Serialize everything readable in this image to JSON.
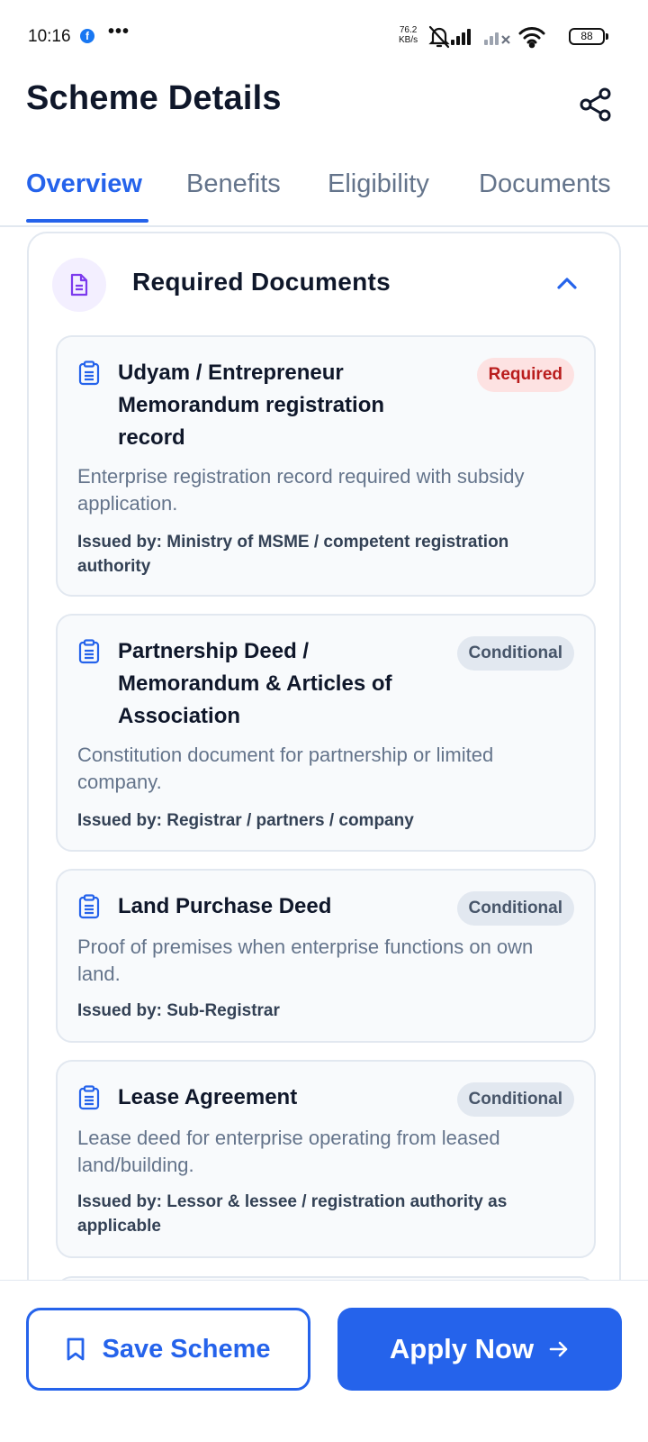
{
  "status_bar": {
    "time": "10:16",
    "fb_glyph": "f",
    "more": "•••",
    "speed_value": "76.2",
    "speed_unit": "KB/s",
    "battery": "88",
    "icons": [
      "facebook-icon",
      "mute-bell-icon",
      "signal-icon",
      "signal-no-service-icon",
      "wifi-icon",
      "battery-icon"
    ]
  },
  "header": {
    "title": "Scheme Details",
    "share_icon": "share-icon"
  },
  "tabs": [
    {
      "label": "Overview",
      "active": true
    },
    {
      "label": "Benefits",
      "active": false
    },
    {
      "label": "Eligibility",
      "active": false
    },
    {
      "label": "Documents",
      "active": false
    }
  ],
  "section": {
    "title": "Required Documents",
    "icon": "document-icon",
    "expanded": true,
    "documents": [
      {
        "title": "Udyam / Entrepreneur Memorandum registration record",
        "badge": "Required",
        "badge_type": "required",
        "description": "Enterprise registration record required with subsidy application.",
        "issued_by": "Issued by: Ministry of MSME / competent registration authority"
      },
      {
        "title": "Partnership Deed / Memorandum & Articles of Association",
        "badge": "Conditional",
        "badge_type": "conditional",
        "description": "Constitution document for partnership or limited company.",
        "issued_by": "Issued by: Registrar / partners / company"
      },
      {
        "title": "Land Purchase Deed",
        "badge": "Conditional",
        "badge_type": "conditional",
        "description": "Proof of premises when enterprise functions on own land.",
        "issued_by": "Issued by: Sub-Registrar"
      },
      {
        "title": "Lease Agreement",
        "badge": "Conditional",
        "badge_type": "conditional",
        "description": "Lease deed for enterprise operating from leased land/building.",
        "issued_by": "Issued by: Lessor & lessee / registration authority as applicable"
      }
    ]
  },
  "actions": {
    "save_label": "Save Scheme",
    "apply_label": "Apply Now"
  },
  "colors": {
    "accent": "#2563eb",
    "required_bg": "#fde2e2",
    "required_text": "#b91c1c",
    "conditional_bg": "#e2e8f0",
    "conditional_text": "#475569",
    "section_icon": "#7c3aed"
  }
}
